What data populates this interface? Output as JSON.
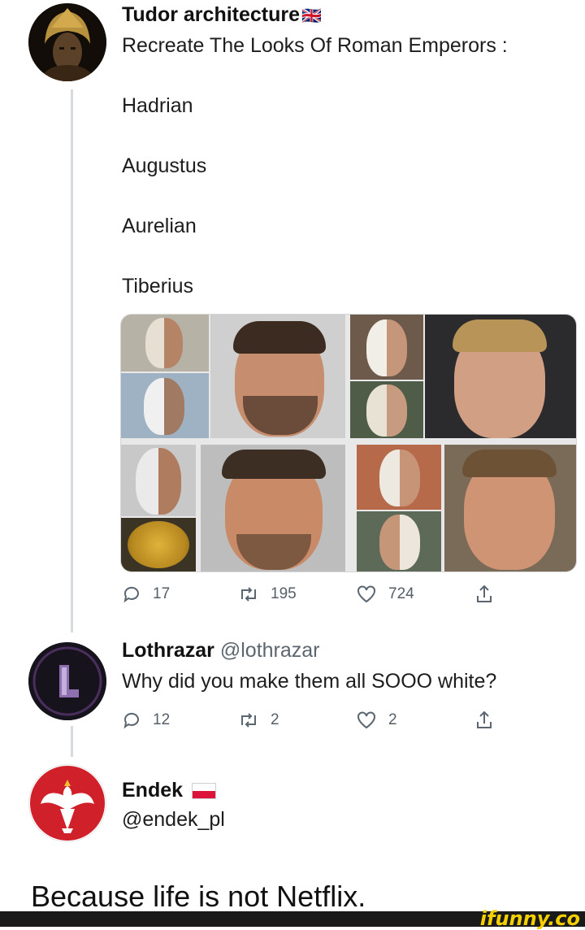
{
  "tweet1": {
    "name": "Tudor architecture",
    "flag": "🇬🇧",
    "text": "Recreate The Looks Of Roman Emperors :",
    "emperors": [
      "Hadrian",
      "Augustus",
      "Aurelian",
      "Tiberius"
    ],
    "replies": "17",
    "retweets": "195",
    "likes": "724"
  },
  "tweet2": {
    "name": "Lothrazar",
    "handle": "@lothrazar",
    "text": "Why did you make them all SOOO white?",
    "replies": "12",
    "retweets": "2",
    "likes": "2"
  },
  "tweet3": {
    "name": "Endek",
    "handle": "@endek_pl",
    "text": "Because life is not Netflix."
  },
  "watermark": "ifunny.co",
  "icons": [
    "reply-icon",
    "retweet-icon",
    "like-icon",
    "share-icon"
  ],
  "colors": {
    "thread_line": "#d7dbdf",
    "text": "#1b1b1b",
    "muted": "#5b6670",
    "watermark": "#f5d000"
  }
}
